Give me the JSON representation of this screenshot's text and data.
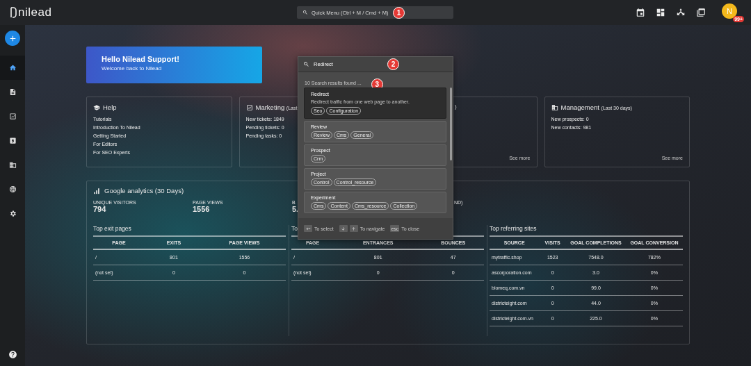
{
  "top_bar": {
    "logo": "nilead",
    "quick_menu": {
      "placeholder": "Quick Menu (Ctrl + M / Cmd + M)",
      "marker": "1"
    },
    "actions": [
      {
        "kind": "calendar"
      },
      {
        "kind": "dashboard"
      },
      {
        "kind": "network"
      },
      {
        "kind": "windows"
      }
    ],
    "avatar": {
      "initial": "N",
      "badge": "99+"
    }
  },
  "sidebar": {
    "items": [
      {
        "kind": "home",
        "selected": true
      },
      {
        "kind": "page",
        "selected": false
      },
      {
        "kind": "chart",
        "selected": false
      },
      {
        "kind": "finance",
        "selected": false
      },
      {
        "kind": "company",
        "selected": false
      },
      {
        "kind": "globe",
        "selected": false
      },
      {
        "kind": "settings",
        "selected": false
      }
    ]
  },
  "welcome": {
    "title": "Hello Nilead Support!",
    "subtitle": "Welcome back to Nilead"
  },
  "cards": [
    {
      "kind": "help",
      "title": "Help",
      "lines": [
        "Tutorials",
        "Introduction To Nilead",
        "Getting Started",
        "For Editors",
        "For SEO Experts"
      ]
    },
    {
      "kind": "marketing",
      "title": "Marketing",
      "note": "(Last",
      "lines": [
        "New tickets: 1849",
        "Pending tickets: 0",
        "Pending tasks: 0"
      ]
    },
    {
      "kind": "hidden",
      "title": ")",
      "see_more": "See more"
    },
    {
      "kind": "management",
      "title": "Management",
      "note": "(Last 30 days)",
      "lines": [
        "New prospects: 0",
        "New contacts: 981"
      ],
      "see_more": "See more"
    }
  ],
  "analytics": {
    "title": "Google analytics (30 Days)",
    "metrics": [
      {
        "label": "UNIQUE VISITORS",
        "value": "794"
      },
      {
        "label": "PAGE VIEWS",
        "value": "1556"
      },
      {
        "label": "B",
        "value": "5."
      },
      {
        "label": "ND)"
      }
    ],
    "tables": [
      {
        "title": "Top exit pages",
        "columns": [
          "PAGE",
          "EXITS",
          "PAGE VIEWS"
        ],
        "rows": [
          [
            "/",
            "801",
            "1556"
          ],
          [
            "(not set)",
            "0",
            "0"
          ]
        ]
      },
      {
        "title": "To",
        "columns": [
          "PAGE",
          "ENTRANCES",
          "BOUNCES"
        ],
        "rows": [
          [
            "/",
            "801",
            "47"
          ],
          [
            "(not set)",
            "0",
            "0"
          ]
        ]
      },
      {
        "title": "Top referring sites",
        "columns": [
          "SOURCE",
          "VISITS",
          "GOAL COMPLETIONS",
          "GOAL CONVERSION"
        ],
        "rows": [
          [
            "mytraffic.shop",
            "1523",
            "7548.0",
            "782%"
          ],
          [
            "ascorporation.com",
            "0",
            "3.0",
            "0%"
          ],
          [
            "biomeq.com.vn",
            "0",
            "99.0",
            "0%"
          ],
          [
            "districteight.com",
            "0",
            "44.0",
            "0%"
          ],
          [
            "districteight.com.vn",
            "0",
            "225.0",
            "0%"
          ]
        ]
      }
    ]
  },
  "search_popup": {
    "query": "Redirect",
    "marker": "2",
    "count": "10 Search results found ...",
    "count_marker": "3",
    "results": [
      {
        "title": "Redirect",
        "description": "Redirect traffic from one web page to another.",
        "tags": [
          "Seo",
          "Configuration"
        ],
        "selected": true
      },
      {
        "title": "Review",
        "tags": [
          "Review",
          "Cms",
          "General"
        ],
        "selected": false
      },
      {
        "title": "Prospect",
        "tags": [
          "Crm"
        ],
        "selected": false
      },
      {
        "title": "Project",
        "tags": [
          "Control",
          "Control_resource"
        ],
        "selected": false
      },
      {
        "title": "Experiment",
        "tags": [
          "Cms",
          "Content",
          "Cms_resource",
          "Collection"
        ],
        "selected": false
      }
    ],
    "hints": [
      {
        "kind": "enter",
        "label": "To select"
      },
      {
        "kind": "arrows",
        "label": "To navigate"
      },
      {
        "kind": "text_key",
        "key": "esc",
        "label": "To close"
      }
    ]
  }
}
